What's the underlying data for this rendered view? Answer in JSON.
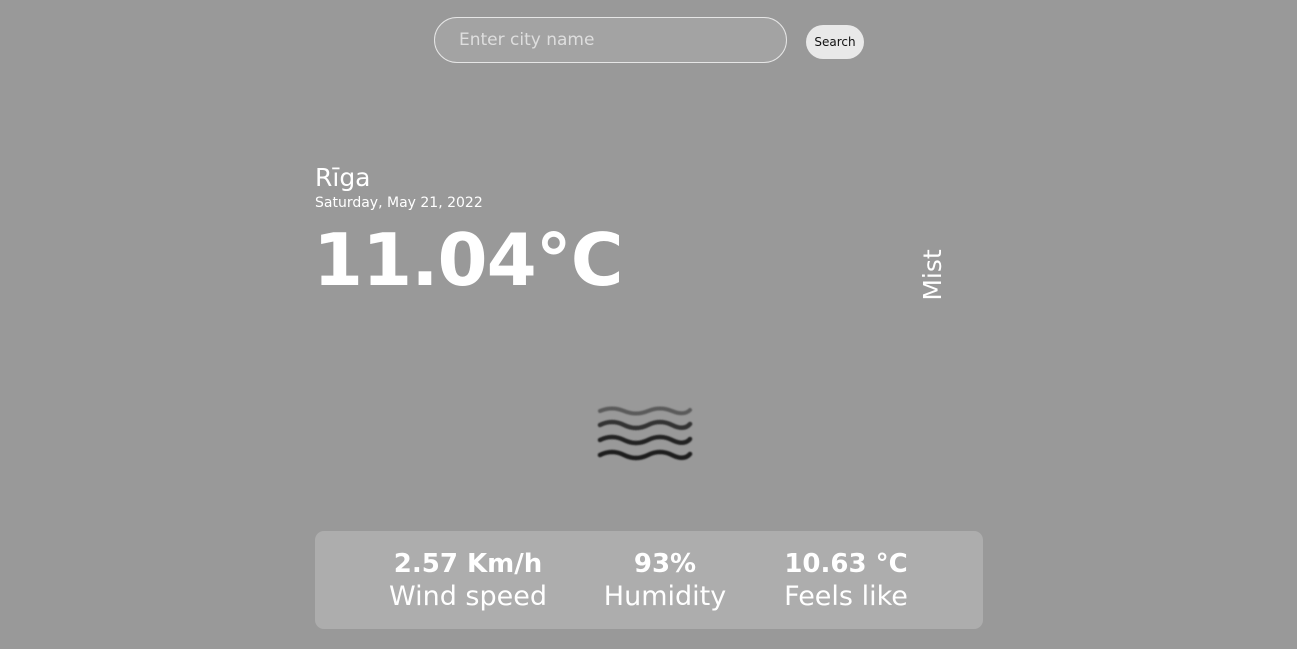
{
  "search": {
    "placeholder": "Enter city name",
    "value": "",
    "button_label": "Search"
  },
  "weather": {
    "city": "Rīga",
    "date": "Saturday, May 21, 2022",
    "temperature": "11.04°C",
    "condition": "Mist",
    "icon": "mist-icon"
  },
  "stats": [
    {
      "value": "2.57 Km/h",
      "label": "Wind speed"
    },
    {
      "value": "93%",
      "label": "Humidity"
    },
    {
      "value": "10.63 °C",
      "label": "Feels like"
    }
  ],
  "colors": {
    "background": "#999999",
    "panel": "#adadad",
    "text": "#ffffff",
    "button": "#e9e9e9"
  }
}
